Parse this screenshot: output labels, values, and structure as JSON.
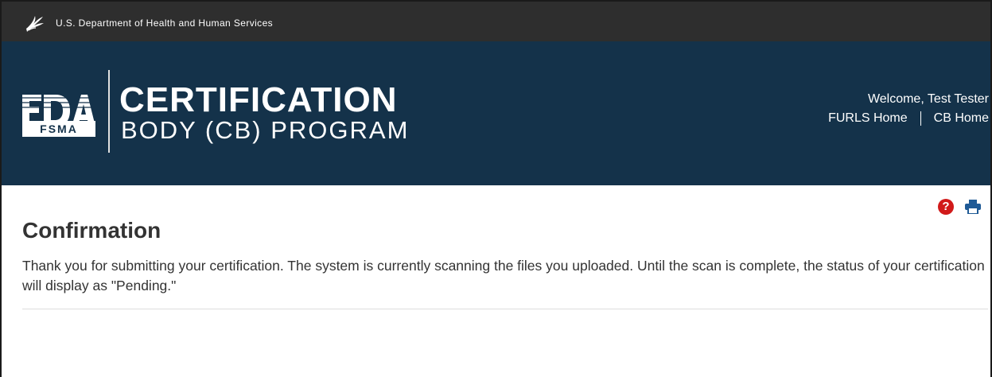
{
  "header": {
    "agency_text": "U.S. Department of Health and Human Services"
  },
  "banner": {
    "logo_text": "FDA",
    "logo_subtext": "FSMA",
    "title_line1": "CERTIFICATION",
    "title_line2": "BODY (CB) PROGRAM",
    "welcome_text": "Welcome, Test Tester",
    "links": {
      "furls_home": "FURLS Home",
      "cb_home": "CB Home"
    }
  },
  "toolbar": {
    "help_glyph": "?"
  },
  "main": {
    "title": "Confirmation",
    "message": "Thank you for submitting your certification. The system is currently scanning the files you uploaded. Until the scan is complete, the status of your certification will display as \"Pending.\""
  },
  "icons": [
    "hhs-eagle-icon",
    "fda-logo",
    "help-icon",
    "print-icon"
  ],
  "colors": {
    "topbar": "#2e2e2e",
    "banner": "#14324a",
    "help_red": "#d11a1a",
    "print_blue": "#1f5a96",
    "text": "#333333"
  }
}
